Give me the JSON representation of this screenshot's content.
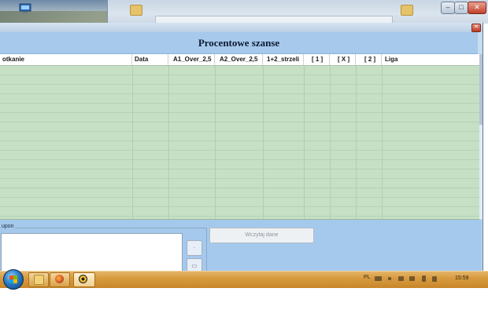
{
  "window": {
    "title": "Procentowe szanse"
  },
  "grid": {
    "columns": [
      {
        "label": "otkanie"
      },
      {
        "label": "Data"
      },
      {
        "label": "A1_Over_2,5"
      },
      {
        "label": "A2_Over_2,5"
      },
      {
        "label": "1+2_strzeli"
      },
      {
        "label": "[ 1 ]"
      },
      {
        "label": "[ X ]"
      },
      {
        "label": "[ 2 ]"
      },
      {
        "label": "Liga"
      }
    ],
    "rows": 16
  },
  "bottom": {
    "kupon_label": "upon",
    "load_button": "Wczytaj dane"
  },
  "taskbar": {
    "language": "PL",
    "clock": "15:59"
  },
  "colors": {
    "grid_bg": "#c6e0c6",
    "panel_bg": "#a7c9ec",
    "taskbar": "#d89b3f"
  }
}
